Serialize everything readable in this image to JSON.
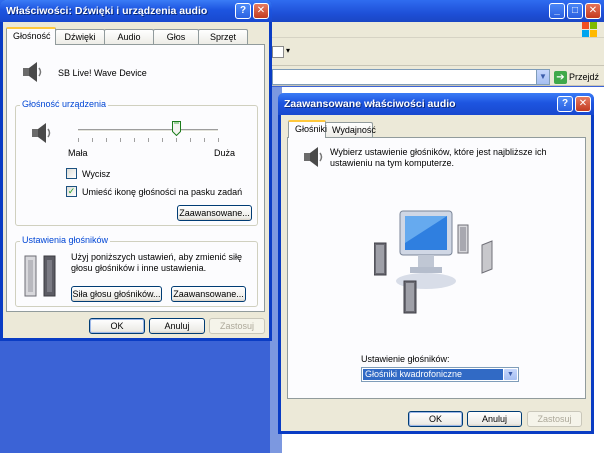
{
  "background_window": {
    "address_go_label": "Przejdź",
    "title_buttons": [
      "_",
      "□",
      "✕"
    ]
  },
  "main_dialog": {
    "title": "Właściwości: Dźwięki i urządzenia audio",
    "help_button": "?",
    "close_button": "✕",
    "tabs": [
      "Głośność",
      "Dźwięki",
      "Audio",
      "Głos",
      "Sprzęt"
    ],
    "device_name": "SB Live! Wave Device",
    "device_volume_group": "Głośność urządzenia",
    "volume_low_label": "Mała",
    "volume_high_label": "Duża",
    "volume_level": 0.7,
    "mute_label": "Wycisz",
    "mute_checked": false,
    "tray_icon_label": "Umieść ikonę głośności na pasku zadań",
    "tray_icon_checked": true,
    "advanced_button": "Zaawansowane...",
    "speaker_settings_group": "Ustawienia głośników",
    "speaker_settings_desc_1": "Użyj poniższych ustawień, aby zmienić siłę",
    "speaker_settings_desc_2": "głosu głośników i inne ustawienia.",
    "speaker_volume_button": "Siła głosu głośników...",
    "speaker_advanced_button": "Zaawansowane...",
    "ok_button": "OK",
    "cancel_button": "Anuluj",
    "apply_button": "Zastosuj"
  },
  "advanced_dialog": {
    "title": "Zaawansowane właściwości audio",
    "help_button": "?",
    "close_button": "✕",
    "tabs": [
      "Głośniki",
      "Wydajność"
    ],
    "description_1": "Wybierz ustawienie głośników, które jest najbliższe ich",
    "description_2": "ustawieniu na tym komputerze.",
    "speaker_setup_label": "Ustawienie głośników:",
    "speaker_setup_value": "Głośniki kwadrofoniczne",
    "ok_button": "OK",
    "cancel_button": "Anuluj",
    "apply_button": "Zastosuj"
  },
  "colors": {
    "title_bar": "#1d55e0",
    "dialog_face": "#ece9d8",
    "group_label": "#0046d5",
    "selected_value": "#316ac5"
  }
}
